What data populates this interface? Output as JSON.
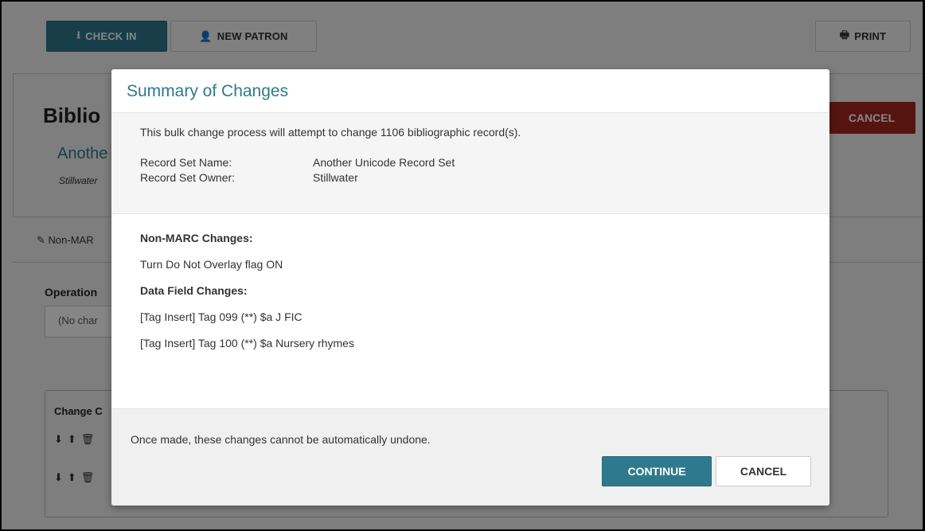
{
  "toolbar": {
    "checkin_label": "CHECK IN",
    "checkin_icon": "⭳",
    "newpatron_label": "NEW PATRON",
    "newpatron_icon": "👤",
    "print_label": "PRINT",
    "print_icon": "🖶"
  },
  "background": {
    "title_partial": "Biblio",
    "recordset_partial": "Anothe",
    "owner_partial": "Stillwater",
    "cancel_label": "CANCEL",
    "tab_partial": "Non-MAR",
    "tab_icon": "✎",
    "operation_label": "Operation",
    "select_value_partial": "(No char",
    "change_label_partial": "Change C",
    "row1_icons": "⬇⬆🗑",
    "row2_icons": "⬇⬆🗑"
  },
  "modal": {
    "title": "Summary of Changes",
    "summary_line": "This bulk change process will attempt to change 1106 bibliographic record(s).",
    "record_set_name_label": "Record Set Name:",
    "record_set_name_value": "Another Unicode Record Set",
    "record_set_owner_label": "Record Set Owner:",
    "record_set_owner_value": "Stillwater",
    "non_marc_heading": "Non-MARC Changes:",
    "non_marc_changes": [
      "Turn Do Not Overlay flag ON"
    ],
    "data_field_heading": "Data Field Changes:",
    "data_field_changes": [
      "[Tag Insert] Tag 099 (**) $a J FIC",
      "[Tag Insert] Tag 100 (**) $a Nursery rhymes"
    ],
    "footer_note": "Once made, these changes cannot be automatically undone.",
    "continue_label": "CONTINUE",
    "cancel_label": "CANCEL"
  },
  "colors": {
    "accent": "#2e7a8c",
    "danger": "#a3281e"
  }
}
